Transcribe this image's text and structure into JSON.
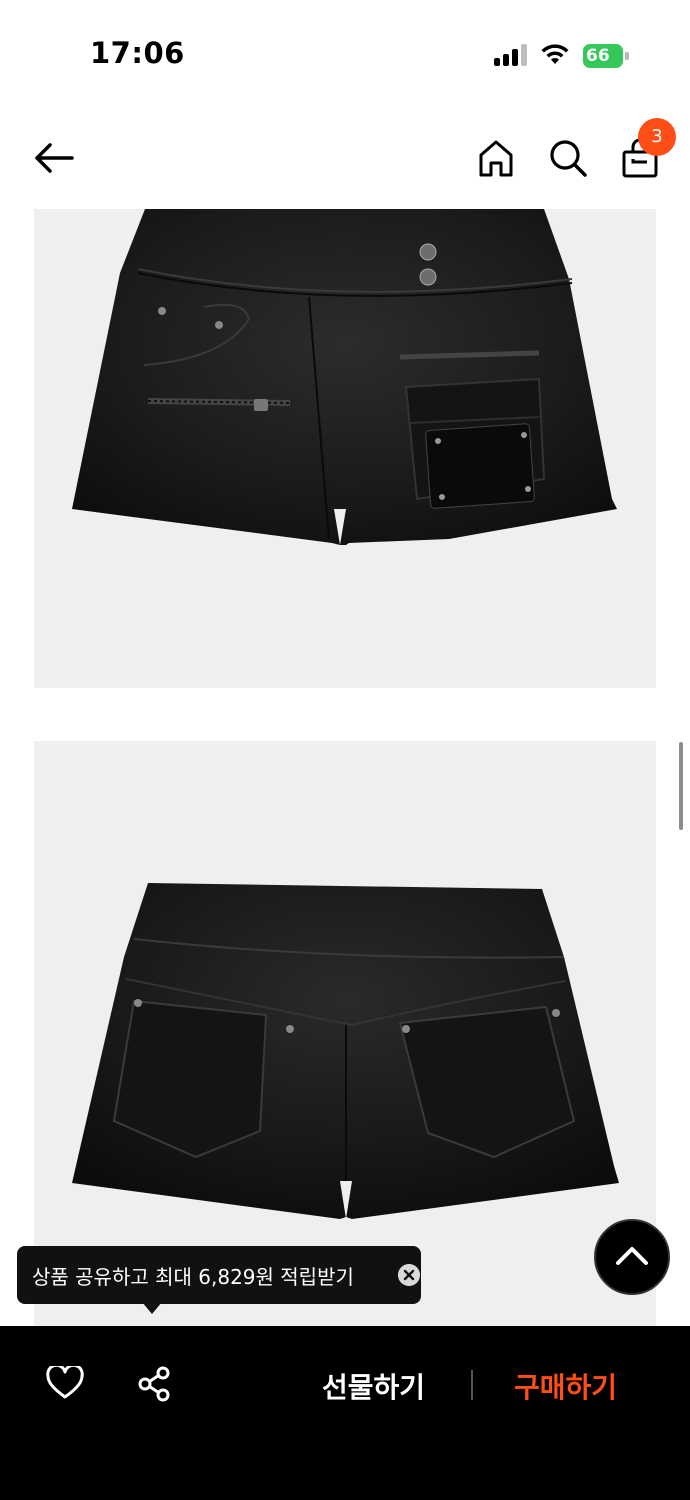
{
  "status": {
    "time": "17:06",
    "battery": "66"
  },
  "header": {
    "cart_count": "3"
  },
  "tooltip": {
    "text": "상품 공유하고 최대 6,829원 적립받기"
  },
  "bottom_bar": {
    "gift_label": "선물하기",
    "buy_label": "구매하기"
  },
  "colors": {
    "accent": "#ff4e16",
    "battery": "#34c759",
    "image_bg": "#efefef"
  },
  "icons": [
    "back-arrow-icon",
    "home-icon",
    "search-icon",
    "shopping-bag-icon",
    "heart-icon",
    "share-icon",
    "close-icon",
    "chevron-up-icon"
  ]
}
